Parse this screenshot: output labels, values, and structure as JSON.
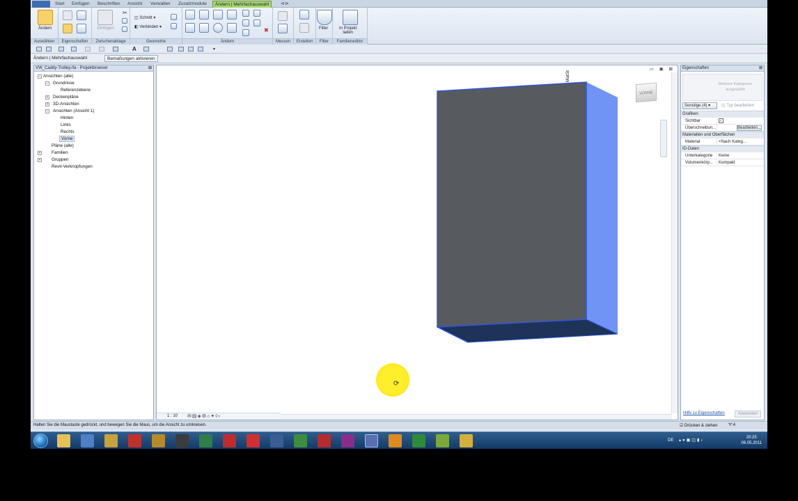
{
  "tabs": [
    "Start",
    "Einfügen",
    "Beschriften",
    "Ansicht",
    "Verwalten",
    "Zusatzmodule",
    "Ändern | Mehrfachauswahl"
  ],
  "ribbon": {
    "select_label": "Ändern",
    "paste_label": "Einfügen",
    "schnitt_label": "Schnitt",
    "verbinden_label": "Verbinden",
    "filter_label": "Filter",
    "load_label_1": "In Projekt",
    "load_label_2": "laden",
    "panels": [
      "Auswählen",
      "Eigenschaften",
      "Zwischenablage",
      "Geometrie",
      "Ändern",
      "Messen",
      "Erstellen",
      "Filter",
      "Familieneditor"
    ]
  },
  "context": {
    "title": "Ändern | Mehrfachauswahl",
    "dim_button": "Bemaßungen aktivieren"
  },
  "browser": {
    "title": "VW_Caddy-Trolley.rfa - Projektbrowser",
    "items": [
      "Ansichten (alle)",
      "Grundrisse",
      "Referenzebene",
      "Deckenpläne",
      "3D-Ansichten",
      "Ansichten (Ansicht 1)",
      "Hinten",
      "Links",
      "Rechts",
      "Vorne",
      "Pläne (alle)",
      "Familien",
      "Gruppen",
      "Revit-Verknüpfungen"
    ]
  },
  "view": {
    "label": "MatSt",
    "cube": "VORNE",
    "scale": "1 : 10"
  },
  "properties": {
    "title": "Eigenschaften",
    "type_placeholder": "Mehrere Kategorien ausgewählt",
    "filter_value": "Sonstige (4)",
    "edit_type": "Typ bearbeiten",
    "sections": {
      "grafiken": "Grafiken",
      "materialien": "Materialien und Oberflächen",
      "id_daten": "ID-Daten"
    },
    "rows": {
      "sichtbar_key": "Sichtbar",
      "ueberschreib_key": "Überschreibun...",
      "ueberschreib_btn": "Bearbeiten...",
      "material_key": "Material",
      "material_val": "<Nach Kateg...",
      "unterkategorie_key": "Unterkategorie",
      "unterkategorie_val": "Keine",
      "volumen_key": "Volumenkörp...",
      "volumen_val": "Kompakt"
    },
    "help_link": "Hilfe zu Eigenschaften",
    "apply": "Anwenden"
  },
  "status": {
    "message": "Halten Sie die Maustaste gedrückt, und bewegen Sie die Maus, um die Ansicht zu umkreisen.",
    "drag": "Drücken & ziehen",
    "filter_count": ":4"
  },
  "tray": {
    "lang": "DE",
    "time": "20:25",
    "date": "06.05.2011"
  },
  "colors": {
    "box_face": "#575a5e",
    "box_side": "#6f94f5",
    "box_bottom": "#1d3357",
    "edge": "#2e55e0",
    "cursor": "#ffee2a"
  }
}
